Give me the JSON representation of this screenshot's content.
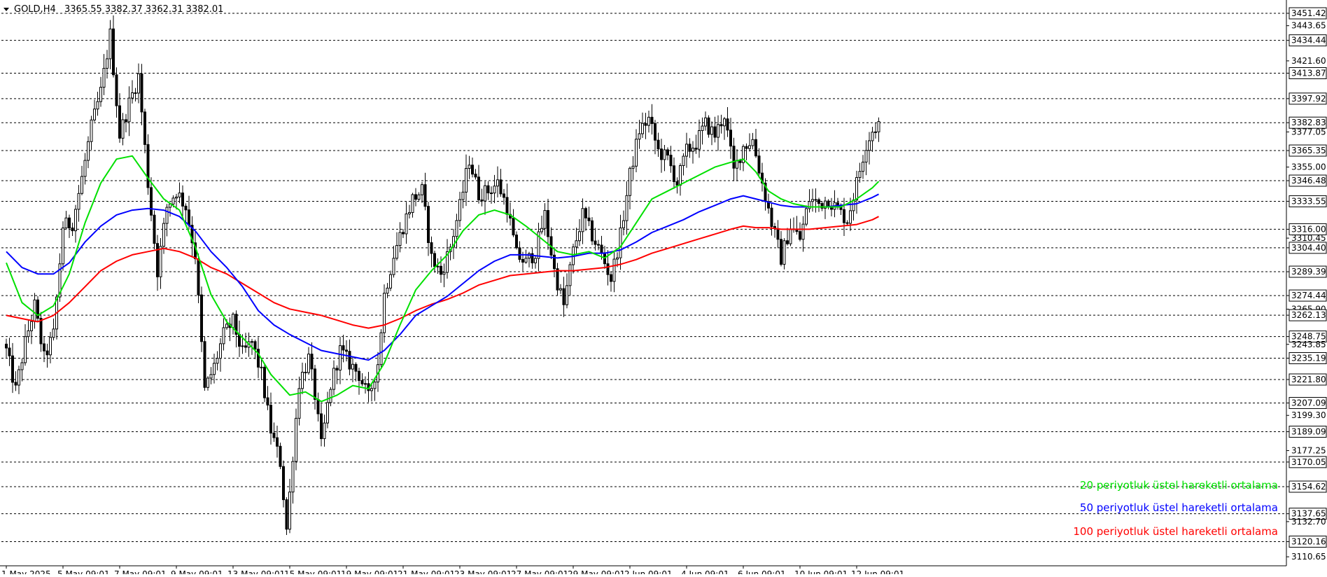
{
  "header": {
    "symbol": "GOLD,H4",
    "ohlc": "3365.55 3382.37 3362.31 3382.01"
  },
  "colors": {
    "ema20": "#00e000",
    "ema50": "#0000ff",
    "ema100": "#ff0000",
    "grid": "#000000",
    "candle": "#000000"
  },
  "chart_data": {
    "type": "candlestick",
    "ylim": [
      3105,
      3458
    ],
    "gridlines": [
      3451.42,
      3434.44,
      3413.87,
      3397.92,
      3382.83,
      3365.35,
      3346.48,
      3333.55,
      3316.0,
      3304.4,
      3289.39,
      3274.44,
      3262.13,
      3248.75,
      3235.19,
      3221.8,
      3207.09,
      3189.09,
      3170.05,
      3154.62,
      3137.65,
      3120.16
    ],
    "y_ticks": [
      "3451.42",
      "3443.65",
      "3434.44",
      "3421.60",
      "3413.87",
      "3397.92",
      "3382.83",
      "3377.05",
      "3365.35",
      "3355.00",
      "3346.48",
      "3333.55",
      "3316.00",
      "3310.45",
      "3304.40",
      "3289.39",
      "3274.44",
      "3265.90",
      "3262.13",
      "3248.75",
      "3243.85",
      "3235.19",
      "3221.80",
      "3207.09",
      "3199.30",
      "3189.09",
      "3177.25",
      "3170.05",
      "3154.62",
      "3137.65",
      "3132.70",
      "3120.16",
      "3110.65"
    ],
    "y_tick_values": [
      3451.42,
      3443.65,
      3434.44,
      3421.6,
      3413.87,
      3397.92,
      3382.83,
      3377.05,
      3365.35,
      3355.0,
      3346.48,
      3333.55,
      3316.0,
      3310.45,
      3304.4,
      3289.39,
      3274.44,
      3265.9,
      3262.13,
      3248.75,
      3243.85,
      3235.19,
      3221.8,
      3207.09,
      3199.3,
      3189.09,
      3177.25,
      3170.05,
      3154.62,
      3137.65,
      3132.7,
      3120.16,
      3110.65
    ],
    "y_tick_boxed": [
      true,
      false,
      true,
      false,
      true,
      true,
      true,
      false,
      true,
      false,
      true,
      true,
      true,
      false,
      true,
      true,
      true,
      false,
      true,
      true,
      false,
      true,
      true,
      true,
      false,
      true,
      false,
      true,
      true,
      true,
      false,
      true,
      false
    ],
    "x_labels": [
      {
        "label": "1 May 2025",
        "bar": 0
      },
      {
        "label": "5 May 09:01",
        "bar": 18
      },
      {
        "label": "7 May 09:01",
        "bar": 36
      },
      {
        "label": "9 May 09:01",
        "bar": 54
      },
      {
        "label": "13 May 09:01",
        "bar": 72
      },
      {
        "label": "15 May 09:01",
        "bar": 90
      },
      {
        "label": "19 May 09:01",
        "bar": 108
      },
      {
        "label": "21 May 09:01",
        "bar": 126
      },
      {
        "label": "23 May 09:01",
        "bar": 144
      },
      {
        "label": "27 May 09:01",
        "bar": 162
      },
      {
        "label": "29 May 09:01",
        "bar": 180
      },
      {
        "label": "2 Jun 09:01",
        "bar": 198
      },
      {
        "label": "4 Jun 09:01",
        "bar": 216
      },
      {
        "label": "6 Jun 09:01",
        "bar": 234
      },
      {
        "label": "10 Jun 09:01",
        "bar": 252
      },
      {
        "label": "12 Jun 09:01",
        "bar": 270
      }
    ],
    "legend": [
      {
        "name": "20 periyotluk üstel hareketli ortalama",
        "color": "#00e000"
      },
      {
        "name": "50 periyotluk üstel hareketli ortalama",
        "color": "#0000ff"
      },
      {
        "name": "100 periyotluk üstel hareketli ortalama",
        "color": "#ff0000"
      }
    ],
    "price_path": [
      [
        0,
        3240
      ],
      [
        3,
        3215
      ],
      [
        6,
        3245
      ],
      [
        9,
        3268
      ],
      [
        12,
        3235
      ],
      [
        15,
        3250
      ],
      [
        18,
        3318
      ],
      [
        21,
        3320
      ],
      [
        24,
        3348
      ],
      [
        27,
        3380
      ],
      [
        30,
        3402
      ],
      [
        33,
        3438
      ],
      [
        36,
        3375
      ],
      [
        39,
        3395
      ],
      [
        42,
        3412
      ],
      [
        45,
        3345
      ],
      [
        48,
        3290
      ],
      [
        51,
        3330
      ],
      [
        54,
        3340
      ],
      [
        57,
        3330
      ],
      [
        60,
        3300
      ],
      [
        63,
        3215
      ],
      [
        66,
        3230
      ],
      [
        69,
        3250
      ],
      [
        72,
        3258
      ],
      [
        75,
        3238
      ],
      [
        78,
        3245
      ],
      [
        81,
        3225
      ],
      [
        84,
        3190
      ],
      [
        87,
        3170
      ],
      [
        89,
        3128
      ],
      [
        90,
        3150
      ],
      [
        91,
        3175
      ],
      [
        93,
        3220
      ],
      [
        96,
        3235
      ],
      [
        98,
        3212
      ],
      [
        100,
        3180
      ],
      [
        103,
        3218
      ],
      [
        106,
        3240
      ],
      [
        109,
        3232
      ],
      [
        112,
        3225
      ],
      [
        115,
        3210
      ],
      [
        118,
        3232
      ],
      [
        120,
        3275
      ],
      [
        123,
        3300
      ],
      [
        126,
        3318
      ],
      [
        129,
        3335
      ],
      [
        132,
        3340
      ],
      [
        135,
        3298
      ],
      [
        138,
        3288
      ],
      [
        141,
        3305
      ],
      [
        144,
        3330
      ],
      [
        147,
        3360
      ],
      [
        150,
        3338
      ],
      [
        153,
        3340
      ],
      [
        156,
        3345
      ],
      [
        159,
        3330
      ],
      [
        162,
        3300
      ],
      [
        165,
        3295
      ],
      [
        168,
        3302
      ],
      [
        171,
        3325
      ],
      [
        174,
        3290
      ],
      [
        177,
        3268
      ],
      [
        180,
        3302
      ],
      [
        183,
        3325
      ],
      [
        186,
        3312
      ],
      [
        189,
        3300
      ],
      [
        192,
        3285
      ],
      [
        195,
        3312
      ],
      [
        198,
        3350
      ],
      [
        201,
        3378
      ],
      [
        204,
        3385
      ],
      [
        207,
        3365
      ],
      [
        210,
        3360
      ],
      [
        213,
        3345
      ],
      [
        216,
        3365
      ],
      [
        219,
        3370
      ],
      [
        222,
        3382
      ],
      [
        225,
        3375
      ],
      [
        228,
        3388
      ],
      [
        231,
        3352
      ],
      [
        234,
        3368
      ],
      [
        237,
        3372
      ],
      [
        240,
        3345
      ],
      [
        243,
        3320
      ],
      [
        246,
        3298
      ],
      [
        249,
        3318
      ],
      [
        252,
        3310
      ],
      [
        255,
        3335
      ],
      [
        258,
        3332
      ],
      [
        261,
        3335
      ],
      [
        264,
        3328
      ],
      [
        267,
        3322
      ],
      [
        270,
        3345
      ],
      [
        273,
        3370
      ],
      [
        275,
        3378
      ],
      [
        277,
        3382
      ]
    ],
    "ema20": [
      [
        0,
        3295
      ],
      [
        5,
        3270
      ],
      [
        10,
        3262
      ],
      [
        15,
        3268
      ],
      [
        20,
        3288
      ],
      [
        25,
        3320
      ],
      [
        30,
        3345
      ],
      [
        35,
        3360
      ],
      [
        40,
        3362
      ],
      [
        45,
        3348
      ],
      [
        50,
        3335
      ],
      [
        55,
        3328
      ],
      [
        60,
        3305
      ],
      [
        65,
        3275
      ],
      [
        70,
        3258
      ],
      [
        75,
        3248
      ],
      [
        80,
        3238
      ],
      [
        84,
        3225
      ],
      [
        90,
        3212
      ],
      [
        95,
        3214
      ],
      [
        100,
        3208
      ],
      [
        105,
        3212
      ],
      [
        110,
        3218
      ],
      [
        115,
        3216
      ],
      [
        120,
        3232
      ],
      [
        125,
        3256
      ],
      [
        130,
        3278
      ],
      [
        135,
        3290
      ],
      [
        140,
        3300
      ],
      [
        145,
        3315
      ],
      [
        150,
        3325
      ],
      [
        155,
        3328
      ],
      [
        160,
        3325
      ],
      [
        165,
        3318
      ],
      [
        170,
        3310
      ],
      [
        175,
        3302
      ],
      [
        180,
        3300
      ],
      [
        185,
        3302
      ],
      [
        190,
        3298
      ],
      [
        195,
        3305
      ],
      [
        200,
        3320
      ],
      [
        205,
        3335
      ],
      [
        210,
        3340
      ],
      [
        215,
        3345
      ],
      [
        220,
        3350
      ],
      [
        225,
        3355
      ],
      [
        230,
        3358
      ],
      [
        234,
        3360
      ],
      [
        238,
        3352
      ],
      [
        242,
        3340
      ],
      [
        246,
        3335
      ],
      [
        250,
        3332
      ],
      [
        255,
        3330
      ],
      [
        260,
        3330
      ],
      [
        265,
        3330
      ],
      [
        270,
        3335
      ],
      [
        275,
        3342
      ],
      [
        277,
        3346
      ]
    ],
    "ema50": [
      [
        0,
        3302
      ],
      [
        5,
        3292
      ],
      [
        10,
        3288
      ],
      [
        15,
        3288
      ],
      [
        20,
        3295
      ],
      [
        25,
        3308
      ],
      [
        30,
        3318
      ],
      [
        35,
        3325
      ],
      [
        40,
        3328
      ],
      [
        45,
        3329
      ],
      [
        50,
        3328
      ],
      [
        55,
        3324
      ],
      [
        60,
        3315
      ],
      [
        65,
        3302
      ],
      [
        70,
        3292
      ],
      [
        75,
        3280
      ],
      [
        80,
        3265
      ],
      [
        85,
        3256
      ],
      [
        90,
        3250
      ],
      [
        95,
        3245
      ],
      [
        100,
        3240
      ],
      [
        105,
        3238
      ],
      [
        110,
        3236
      ],
      [
        115,
        3234
      ],
      [
        120,
        3240
      ],
      [
        125,
        3250
      ],
      [
        130,
        3262
      ],
      [
        135,
        3268
      ],
      [
        140,
        3274
      ],
      [
        145,
        3282
      ],
      [
        150,
        3290
      ],
      [
        155,
        3296
      ],
      [
        160,
        3300
      ],
      [
        165,
        3300
      ],
      [
        170,
        3299
      ],
      [
        175,
        3298
      ],
      [
        180,
        3299
      ],
      [
        185,
        3301
      ],
      [
        190,
        3301
      ],
      [
        195,
        3303
      ],
      [
        200,
        3308
      ],
      [
        205,
        3314
      ],
      [
        210,
        3318
      ],
      [
        215,
        3322
      ],
      [
        220,
        3327
      ],
      [
        225,
        3331
      ],
      [
        230,
        3335
      ],
      [
        234,
        3337
      ],
      [
        238,
        3335
      ],
      [
        242,
        3333
      ],
      [
        246,
        3331
      ],
      [
        250,
        3330
      ],
      [
        255,
        3330
      ],
      [
        260,
        3330
      ],
      [
        265,
        3331
      ],
      [
        270,
        3332
      ],
      [
        275,
        3336
      ],
      [
        277,
        3338
      ]
    ],
    "ema100": [
      [
        0,
        3262
      ],
      [
        5,
        3260
      ],
      [
        10,
        3258
      ],
      [
        15,
        3262
      ],
      [
        20,
        3270
      ],
      [
        25,
        3280
      ],
      [
        30,
        3290
      ],
      [
        35,
        3296
      ],
      [
        40,
        3300
      ],
      [
        45,
        3302
      ],
      [
        50,
        3304
      ],
      [
        55,
        3302
      ],
      [
        60,
        3298
      ],
      [
        65,
        3292
      ],
      [
        70,
        3288
      ],
      [
        75,
        3282
      ],
      [
        80,
        3276
      ],
      [
        85,
        3270
      ],
      [
        90,
        3266
      ],
      [
        95,
        3264
      ],
      [
        100,
        3262
      ],
      [
        105,
        3259
      ],
      [
        110,
        3256
      ],
      [
        115,
        3254
      ],
      [
        120,
        3256
      ],
      [
        125,
        3260
      ],
      [
        130,
        3265
      ],
      [
        135,
        3269
      ],
      [
        140,
        3272
      ],
      [
        145,
        3276
      ],
      [
        150,
        3281
      ],
      [
        155,
        3284
      ],
      [
        160,
        3287
      ],
      [
        165,
        3288
      ],
      [
        170,
        3289
      ],
      [
        175,
        3290
      ],
      [
        180,
        3290
      ],
      [
        185,
        3291
      ],
      [
        190,
        3292
      ],
      [
        195,
        3294
      ],
      [
        200,
        3297
      ],
      [
        205,
        3301
      ],
      [
        210,
        3304
      ],
      [
        215,
        3307
      ],
      [
        220,
        3310
      ],
      [
        225,
        3313
      ],
      [
        230,
        3316
      ],
      [
        234,
        3318
      ],
      [
        238,
        3317
      ],
      [
        242,
        3317
      ],
      [
        246,
        3316
      ],
      [
        250,
        3316
      ],
      [
        255,
        3316
      ],
      [
        260,
        3317
      ],
      [
        265,
        3318
      ],
      [
        270,
        3319
      ],
      [
        275,
        3322
      ],
      [
        277,
        3324
      ]
    ]
  }
}
